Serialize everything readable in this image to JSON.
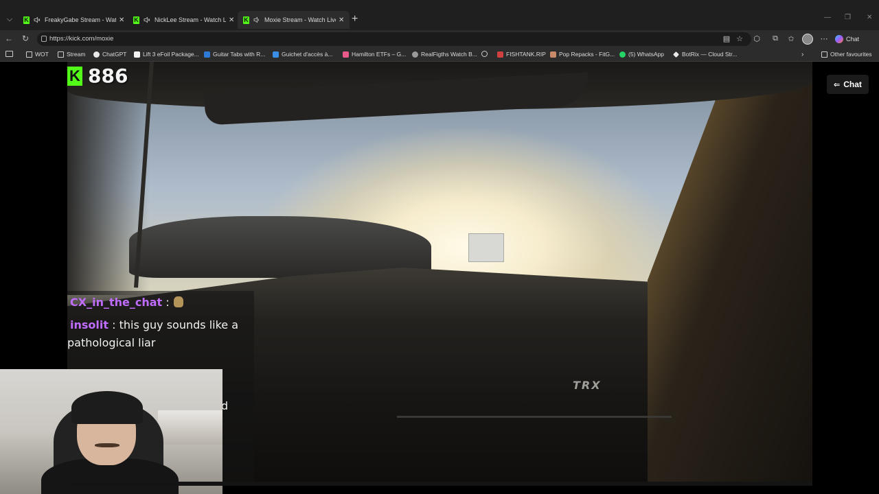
{
  "browser": {
    "tabs": [
      {
        "title": "FreakyGabe Stream - Watch L",
        "muted": true,
        "active": false
      },
      {
        "title": "NickLee Stream - Watch Live",
        "muted": true,
        "active": false
      },
      {
        "title": "Moxie Stream - Watch Live o",
        "muted": false,
        "active": true
      }
    ],
    "url": "https://kick.com/moxie",
    "chat_label": "Chat",
    "bookmarks": [
      {
        "label": "WOT",
        "icon": "folder-icon"
      },
      {
        "label": "Stream",
        "icon": "folder-icon"
      },
      {
        "label": "ChatGPT",
        "icon": "chatgpt-icon"
      },
      {
        "label": "Lift 3 eFoil Package...",
        "icon": "lift-icon"
      },
      {
        "label": "Guitar Tabs with R...",
        "icon": "tabs-icon"
      },
      {
        "label": "Guichet d'accès à...",
        "icon": "guichet-icon"
      },
      {
        "label": "Hamilton ETFs – G...",
        "icon": "hamilton-icon"
      },
      {
        "label": "RealFigths Watch B...",
        "icon": "wordpress-icon"
      },
      {
        "label": "",
        "icon": "globe-icon"
      },
      {
        "label": "FISHTANK.RIP",
        "icon": "fishtank-icon"
      },
      {
        "label": "Pop Repacks - FitG...",
        "icon": "fitgirl-icon"
      },
      {
        "label": "(5) WhatsApp",
        "icon": "whatsapp-icon"
      },
      {
        "label": "BotRix — Cloud Str...",
        "icon": "botrix-icon"
      }
    ],
    "other_favourites": "Other favourites"
  },
  "stream": {
    "viewer_count": "886",
    "chat_toggle_label": "Chat",
    "badge_text": "TRX",
    "chat_messages": [
      {
        "user": "CX_in_the_chat",
        "separator": " :",
        "text": ""
      },
      {
        "user": "insolit",
        "separator": " :",
        "text": " this guy sounds like a"
      },
      {
        "user": "",
        "separator": "",
        "text": "pathological liar"
      }
    ],
    "partial_text": "d"
  },
  "colors": {
    "kick_green": "#53fc18",
    "chat_user": "#c06cff"
  }
}
